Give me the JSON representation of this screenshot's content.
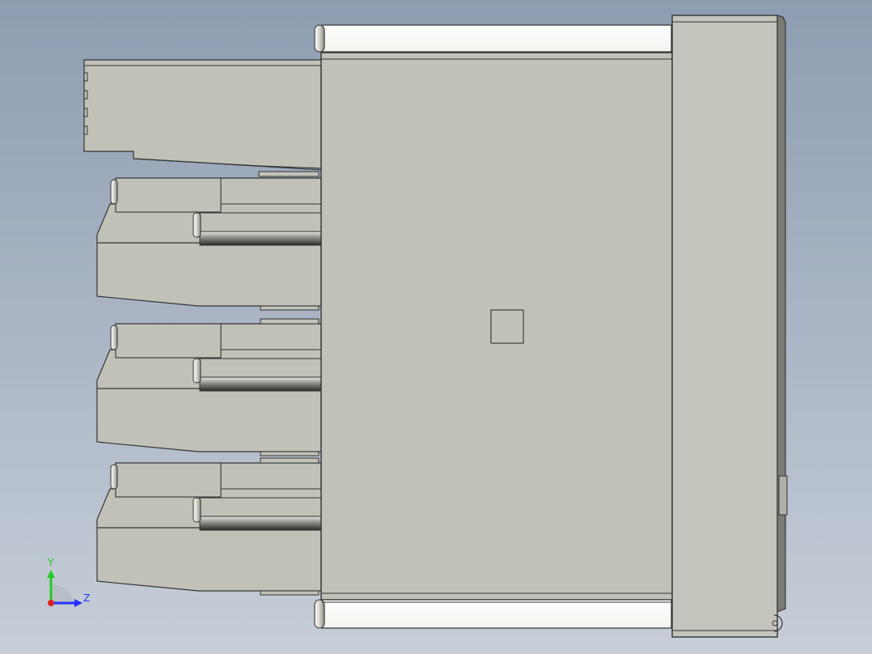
{
  "app": {
    "view": "cad-3d-viewport",
    "background_top": "#8d9db1",
    "background_bottom": "#c7ced8"
  },
  "model": {
    "face_color": "#c1c1b8",
    "edge_color": "#333333",
    "highlight_color": "#ffffff",
    "dark_strip_color": "#4a4a4a",
    "connector_count": 3
  },
  "triad": {
    "y_label": "Y",
    "z_label": "Z",
    "y_color": "#22cc22",
    "z_color": "#2233ff",
    "origin_color": "#dd2222"
  }
}
